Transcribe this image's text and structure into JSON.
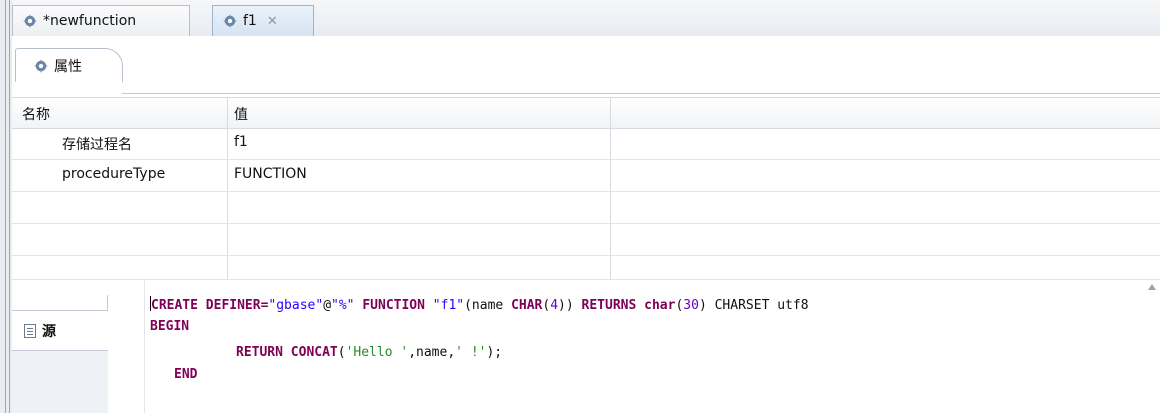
{
  "editor_tabs": [
    {
      "label": "*newfunction"
    },
    {
      "label": "f1",
      "close": "✕"
    }
  ],
  "properties_tab": {
    "label": "属性"
  },
  "grid": {
    "columns": [
      "名称",
      "值"
    ],
    "rows": [
      {
        "name": "存储过程名",
        "value": "f1"
      },
      {
        "name": "procedureType",
        "value": "FUNCTION"
      },
      {
        "name": "",
        "value": ""
      },
      {
        "name": "",
        "value": ""
      },
      {
        "name": "",
        "value": ""
      }
    ]
  },
  "source_tab": {
    "label": "源"
  },
  "code": {
    "line1": {
      "t1": "CREATE DEFINER=",
      "t2": "\"gbase\"",
      "t3": "@",
      "t4": "\"%\"",
      "t5": " FUNCTION ",
      "t6": "\"f1\"",
      "t7": "(name ",
      "t8": "CHAR",
      "t9": "(",
      "t10": "4",
      "t11": ")) ",
      "t12": "RETURNS",
      "t13": " ",
      "t14": "char",
      "t15": "(",
      "t16": "30",
      "t17": ") CHARSET utf8"
    },
    "line2": "BEGIN",
    "line3": {
      "t1": "RETURN CONCAT",
      "t2": "(",
      "t3": "'Hello '",
      "t4": ",name,",
      "t5": "' !'",
      "t6": ");"
    },
    "line4": "END"
  },
  "colors": {
    "keyword": "#7f0055",
    "string": "#2a00ff",
    "string_single": "#2a8a2a",
    "number": "#6a00c8"
  },
  "icons": [
    "gear-icon",
    "close-icon",
    "document-icon",
    "scroll-up-icon"
  ]
}
